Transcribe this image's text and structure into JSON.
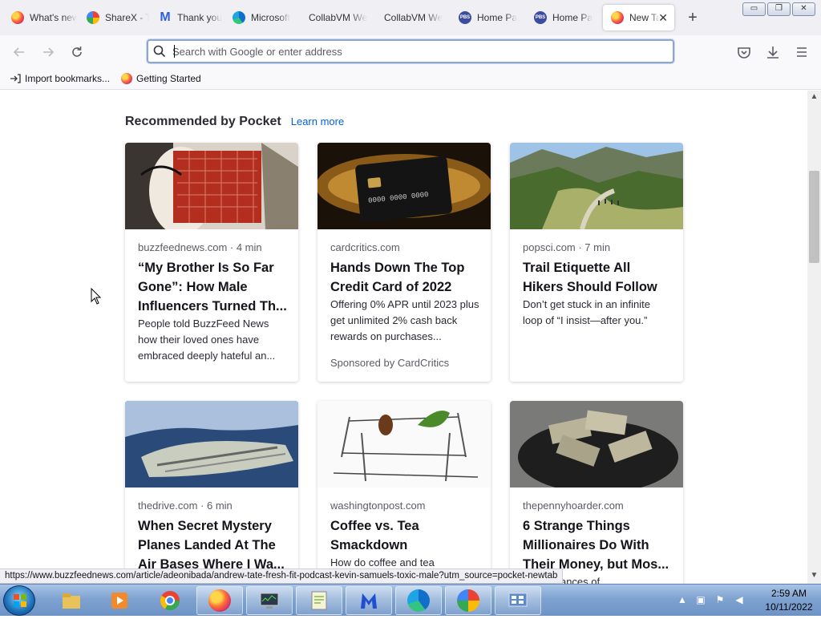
{
  "tabs": [
    {
      "label": "What's new",
      "icon": "firefox-icon",
      "active": false
    },
    {
      "label": "ShareX - T",
      "icon": "sharex-icon",
      "active": false
    },
    {
      "label": "Thank you",
      "icon": "malwarebytes-icon",
      "active": false
    },
    {
      "label": "Microsoft",
      "icon": "edge-icon",
      "active": false
    },
    {
      "label": "CollabVM We",
      "icon": "",
      "active": false
    },
    {
      "label": "CollabVM We",
      "icon": "",
      "active": false
    },
    {
      "label": "Home Pa",
      "icon": "pbs-icon",
      "active": false
    },
    {
      "label": "Home Pa",
      "icon": "pbs-icon",
      "active": false
    },
    {
      "label": "New Tab",
      "icon": "firefox-icon",
      "active": true
    }
  ],
  "window_controls": {
    "minimize": "▭",
    "restore": "❐",
    "close": "✕"
  },
  "newtab_symbol": "+",
  "urlbar": {
    "placeholder": "Search with Google or enter address",
    "value": ""
  },
  "bookmarks": [
    {
      "label": "Import bookmarks...",
      "icon": "import-icon"
    },
    {
      "label": "Getting Started",
      "icon": "firefox-icon"
    }
  ],
  "pocket": {
    "title": "Recommended by Pocket",
    "learn_more": "Learn more",
    "cards": [
      {
        "source": "buzzfeednews.com · 4 min",
        "title": "“My Brother Is So Far Gone”: How Male Influencers Turned Th...",
        "excerpt": "People told BuzzFeed News how their loved ones have embraced deeply hateful an...",
        "sponsor": ""
      },
      {
        "source": "cardcritics.com",
        "title": "Hands Down The Top Credit Card of 2022",
        "excerpt": "Offering 0% APR until 2023 plus get unlimited 2% cash back rewards on purchases...",
        "sponsor": "Sponsored by CardCritics"
      },
      {
        "source": "popsci.com · 7 min",
        "title": "Trail Etiquette All Hikers Should Follow",
        "excerpt": "Don’t get stuck in an infinite loop of “I insist—after you.”",
        "sponsor": ""
      },
      {
        "source": "thedrive.com · 6 min",
        "title": "When Secret Mystery Planes Landed At The Air Bases Where I Wa...",
        "excerpt": "",
        "sponsor": ""
      },
      {
        "source": "washingtonpost.com",
        "title": "Coffee vs. Tea Smackdown",
        "excerpt": "How do coffee and tea",
        "sponsor": ""
      },
      {
        "source": "thepennyhoarder.com",
        "title": "6 Strange Things Millionaires Do With Their Money, but Mos...",
        "excerpt": "...our chances of",
        "sponsor": ""
      }
    ]
  },
  "status_url": "https://www.buzzfeednews.com/article/adeonibada/andrew-tate-fresh-fit-podcast-kevin-samuels-toxic-male?utm_source=pocket-newtab",
  "clock": {
    "time": "2:59 AM",
    "date": "10/11/2022"
  }
}
